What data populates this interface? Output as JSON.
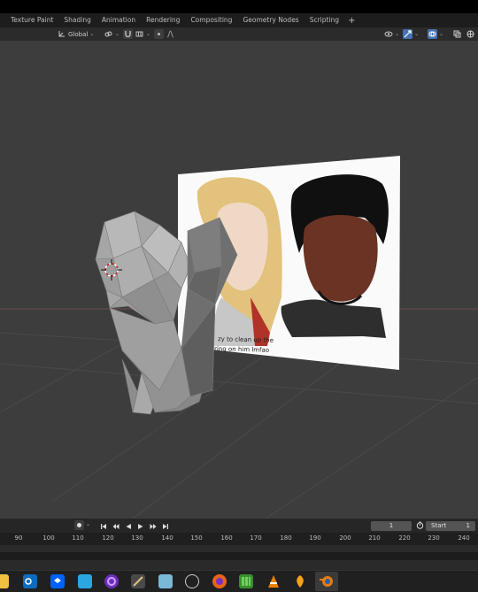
{
  "workspace_tabs": [
    "Texture Paint",
    "Shading",
    "Animation",
    "Rendering",
    "Compositing",
    "Geometry Nodes",
    "Scripting"
  ],
  "workspace_add": "+",
  "header": {
    "orientation_label": "Global",
    "orientation_icon": "axes-icon",
    "snap_icon": "magnet-icon",
    "proportional_icon": "proportional-icon",
    "overlay_icon": "overlay-icon",
    "gizmo_icon": "gizmo-icon",
    "shading_icon": "shading-icon"
  },
  "image_plane": {
    "caption_line1": "zy to clean up the",
    "caption_line2": "ring on him lmfao"
  },
  "timeline": {
    "current_frame": "1",
    "start_label": "Start",
    "start_value": "1",
    "ruler_ticks": [
      "90",
      "100",
      "110",
      "120",
      "130",
      "140",
      "150",
      "160",
      "170",
      "180",
      "190",
      "200",
      "210",
      "220",
      "230",
      "240"
    ]
  },
  "colors": {
    "viewport_bg": "#3d3d3d",
    "header_bg": "#2b2b2b",
    "accent": "#4772b3",
    "mesh": "#9a9a9a"
  },
  "taskbar_icons": [
    "file-explorer-icon",
    "outlook-icon",
    "dropbox-icon",
    "paint-icon",
    "circle-app-icon",
    "brush-app-icon",
    "notes-icon",
    "chrome-icon",
    "firefox-icon",
    "minecraft-icon",
    "vlc-icon",
    "fl-studio-icon",
    "blender-icon"
  ]
}
